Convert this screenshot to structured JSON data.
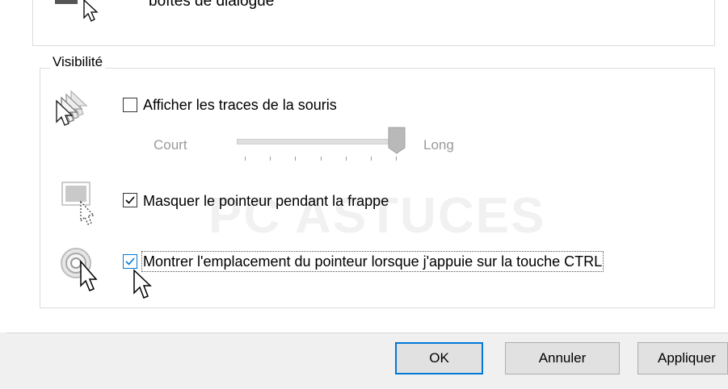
{
  "previous_group": {
    "partial_label": "boîtes de dialogue"
  },
  "visibility": {
    "title": "Visibilité",
    "trails": {
      "label": "Afficher les traces de la souris",
      "checked": false,
      "slider_short": "Court",
      "slider_long": "Long",
      "slider_level": 1.0,
      "icon": "mouse-trails-icon"
    },
    "hide_pointer": {
      "label": "Masquer le pointeur pendant la frappe",
      "checked": true,
      "icon": "hide-pointer-icon"
    },
    "show_location": {
      "label": "Montrer l'emplacement du pointeur lorsque j'appuie sur la touche CTRL",
      "checked": true,
      "icon": "pointer-location-icon"
    }
  },
  "watermark": "PC ASTUCES",
  "buttons": {
    "ok": "OK",
    "cancel": "Annuler",
    "apply": "Appliquer"
  },
  "colors": {
    "accent": "#0078d7",
    "panel": "#ffffff",
    "chrome": "#f0f0f0"
  }
}
